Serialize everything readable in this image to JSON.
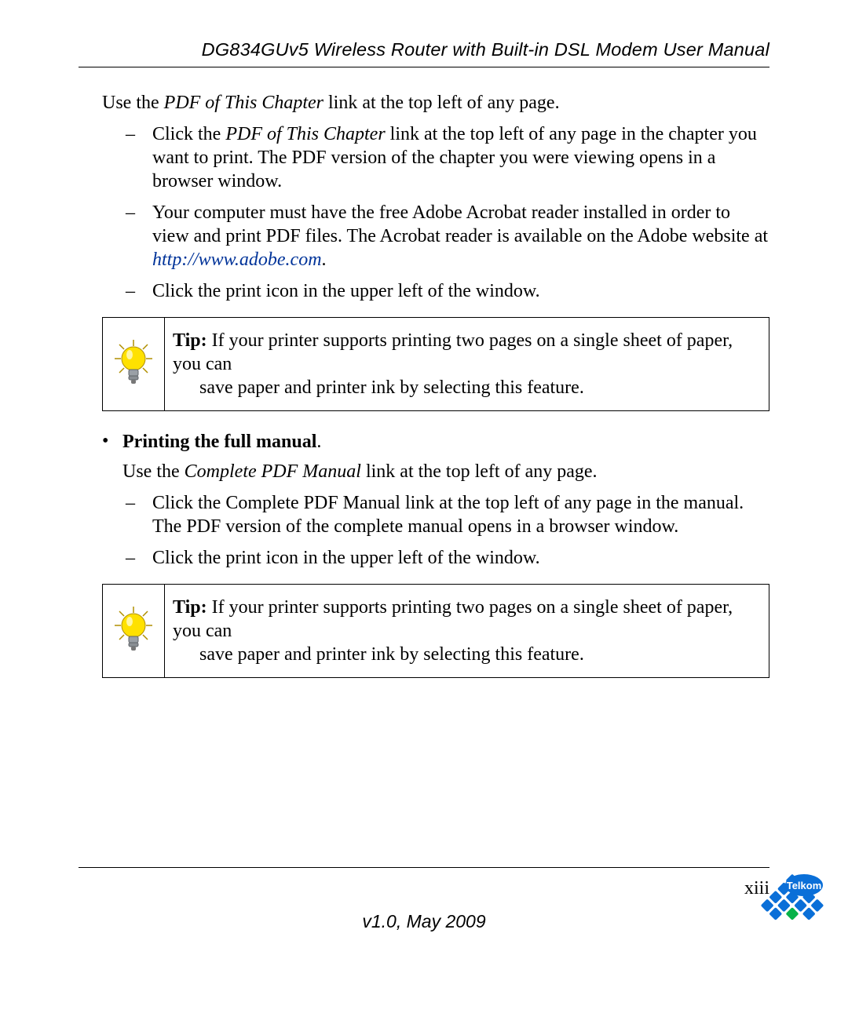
{
  "header_title": "DG834GUv5 Wireless Router with Built-in DSL Modem User Manual",
  "section1": {
    "use_prefix": "Use the ",
    "use_ital": "PDF of This Chapter",
    "use_suffix": " link at the top left of any page.",
    "items": {
      "a_prefix": "Click the ",
      "a_ital": "PDF of This Chapter",
      "a_suffix": " link at the top left of any page in the chapter you want to print. The PDF version of the chapter you were viewing opens in a browser window.",
      "b_prefix": "Your computer must have the free Adobe Acrobat reader installed in order to view and print PDF files. The Acrobat reader is available on the Adobe website at ",
      "b_link": "http://www.adobe.com",
      "b_suffix": ".",
      "c": "Click the print icon in the upper left of the window."
    }
  },
  "tip1": {
    "label": "Tip:",
    "line1_rest": " If your printer supports printing two pages on a single sheet of paper, you can",
    "line2": "save paper and printer ink by selecting this feature."
  },
  "section2": {
    "bullet_heading": "Printing the full manual",
    "bullet_trailing": ".",
    "use_prefix": "Use the ",
    "use_ital": "Complete PDF Manual",
    "use_suffix": " link at the top left of any page.",
    "items": {
      "a": "Click the Complete PDF Manual link at the top left of any page in the manual. The PDF version of the complete manual opens in a browser window.",
      "b": "Click the print icon in the upper left of the window."
    }
  },
  "tip2": {
    "label": "Tip:",
    "line1_rest": " If your printer supports printing two pages on a single sheet of paper, you can",
    "line2": "save paper and printer ink by selecting this feature."
  },
  "footer": {
    "page_number": "xiii",
    "version": "v1.0, May 2009"
  },
  "logo": {
    "brand": "Telkom",
    "primary": "#0a6fd8",
    "accent": "#07b24a"
  }
}
